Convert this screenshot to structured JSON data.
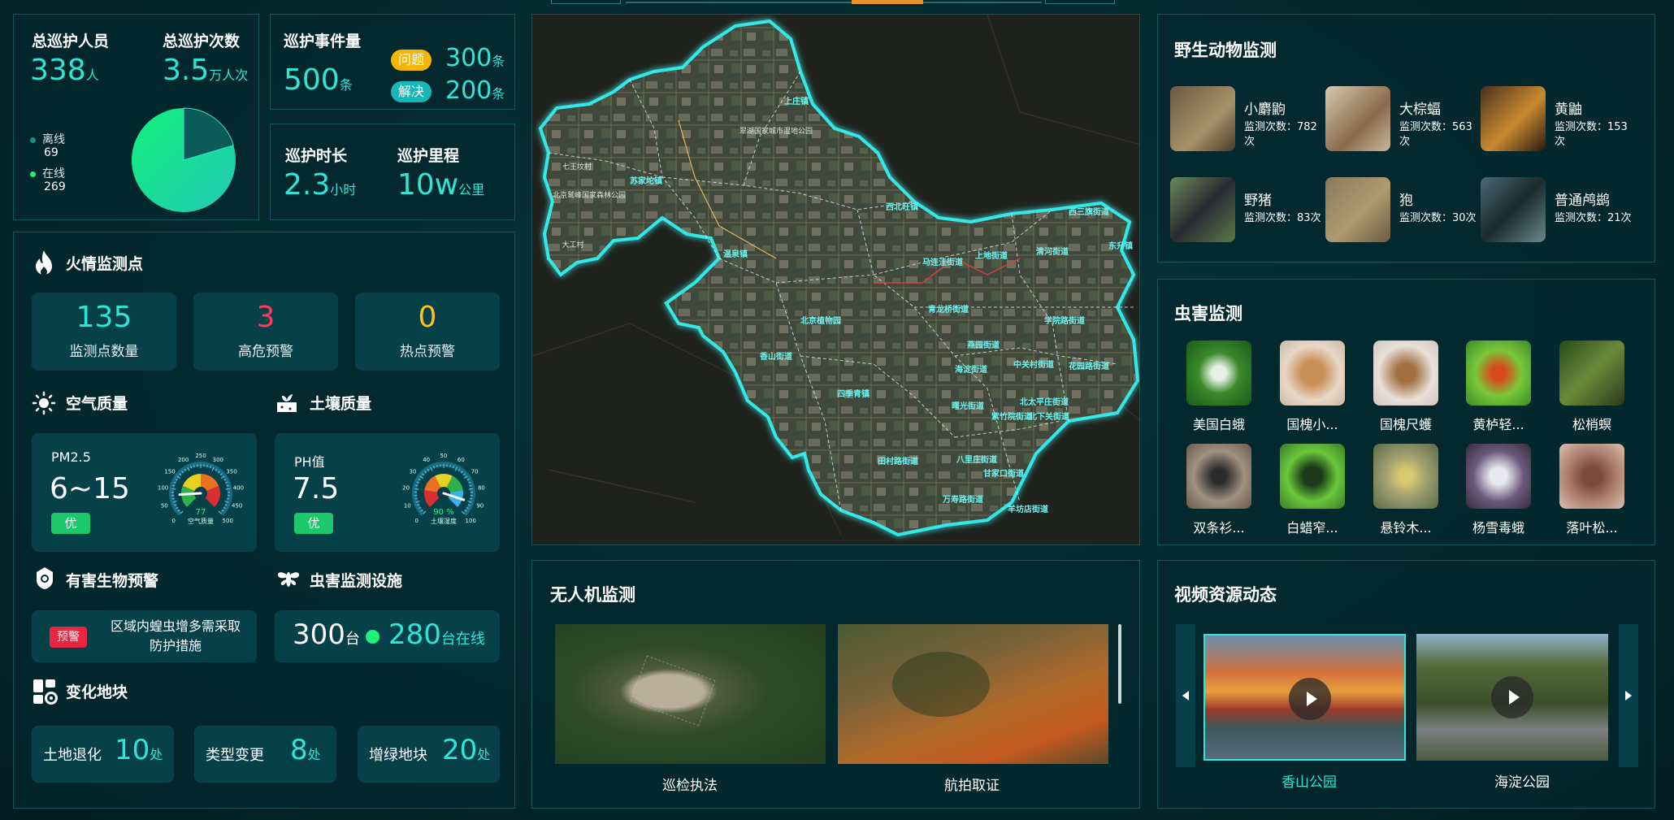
{
  "patrol": {
    "staff_label": "总巡护人员",
    "staff_value": "338",
    "staff_unit": "人",
    "count_label": "总巡护次数",
    "count_value": "3.5",
    "count_unit": "万人次",
    "offline_label": "离线",
    "offline_value": "69",
    "online_label": "在线",
    "online_value": "269",
    "pie": {
      "offline": 69,
      "online": 269
    }
  },
  "events": {
    "label": "巡护事件量",
    "value": "500",
    "unit": "条",
    "problem_tag": "问题",
    "problem_value": "300",
    "problem_unit": "条",
    "solved_tag": "解决",
    "solved_value": "200",
    "solved_unit": "条"
  },
  "duration": {
    "label": "巡护时长",
    "value": "2.3",
    "unit": "小时",
    "mileage_label": "巡护里程",
    "mileage_value": "10w",
    "mileage_unit": "公里"
  },
  "fire": {
    "title": "火情监测点",
    "stats": [
      {
        "value": "135",
        "label": "监测点数量",
        "color": "#2ee6d6"
      },
      {
        "value": "3",
        "label": "高危预警",
        "color": "#ff3b5c"
      },
      {
        "value": "0",
        "label": "热点预警",
        "color": "#ffc21a"
      }
    ]
  },
  "air": {
    "title": "空气质量",
    "metric": "PM2.5",
    "value": "6~15",
    "badge": "优",
    "gauge_value": "77",
    "gauge_caption": "空气质量",
    "gauge_ticks": [
      "0",
      "50",
      "100",
      "150",
      "200",
      "250",
      "300",
      "350",
      "400",
      "450",
      "500"
    ],
    "gauge_fraction": 0.154
  },
  "soil": {
    "title": "土壤质量",
    "metric": "PH值",
    "value": "7.5",
    "badge": "优",
    "gauge_value": "90 %",
    "gauge_caption": "土壤湿度",
    "gauge_ticks": [
      "0",
      "10",
      "20",
      "30",
      "40",
      "50",
      "60",
      "70",
      "80",
      "90",
      "100"
    ],
    "gauge_fraction": 0.9
  },
  "pest_warning": {
    "title": "有害生物预警",
    "tag": "预警",
    "text": "区域内蝗虫增多需采取防护措施"
  },
  "pest_facility": {
    "title": "虫害监测设施",
    "total": "300",
    "total_unit": "台",
    "online": "280",
    "online_unit": "台在线"
  },
  "land": {
    "title": "变化地块",
    "items": [
      {
        "label": "土地退化",
        "value": "10",
        "unit": "处"
      },
      {
        "label": "类型变更",
        "value": "8",
        "unit": "处"
      },
      {
        "label": "增绿地块",
        "value": "20",
        "unit": "处"
      }
    ]
  },
  "wildlife": {
    "title": "野生动物监测",
    "items": [
      {
        "name": "小麝鼩",
        "count": "监测次数：782次"
      },
      {
        "name": "大棕蝠",
        "count": "监测次数：563次"
      },
      {
        "name": "黄鼬",
        "count": "监测次数：153次"
      },
      {
        "name": "野猪",
        "count": "监测次数：83次"
      },
      {
        "name": "狍",
        "count": "监测次数：30次"
      },
      {
        "name": "普通鸬鹚",
        "count": "监测次数：21次"
      }
    ]
  },
  "pests": {
    "title": "虫害监测",
    "items": [
      "美国白蛾",
      "国槐小...",
      "国槐尺蠖",
      "黄栌轻...",
      "松梢螟",
      "双条衫...",
      "白蜡窄...",
      "悬铃木...",
      "杨雪毒蛾",
      "落叶松..."
    ]
  },
  "drone": {
    "title": "无人机监测",
    "items": [
      "巡检执法",
      "航拍取证"
    ]
  },
  "video": {
    "title": "视频资源动态",
    "items": [
      "香山公园",
      "海淀公园"
    ],
    "active_color": "#2ee6d6"
  },
  "map": {
    "places": [
      "上庄镇",
      "苏家坨镇",
      "温泉镇",
      "西北旺镇",
      "北京植物园",
      "香山街道",
      "四季青镇",
      "海淀街道",
      "中关村街道",
      "学院路街道",
      "清河街道",
      "西三旗街道",
      "东升镇",
      "马连洼街道",
      "上地街道",
      "青龙桥街道",
      "燕园街道",
      "花园路街道",
      "北太平庄街道",
      "八里庄街道",
      "甘家口街道",
      "羊坊店街道",
      "万寿路街道",
      "田村路街道",
      "紫竹院街道",
      "北下关街道",
      "曙光街道",
      "七王坟村",
      "北京鹫峰国家森林公园",
      "大工村",
      "翠湖国家城市湿地公园"
    ]
  }
}
